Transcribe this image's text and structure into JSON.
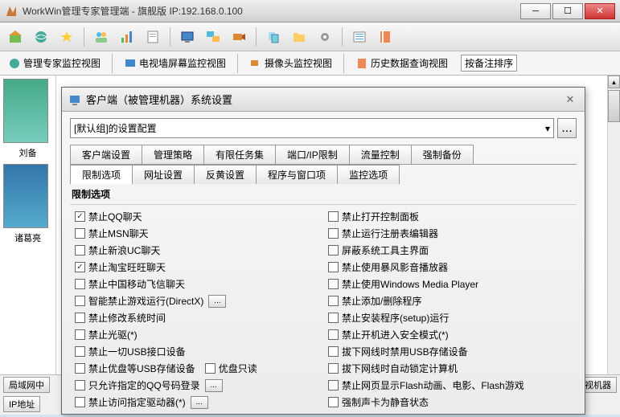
{
  "title": "WorkWin管理专家管理端 - 旗舰版 IP:192.168.0.100",
  "views": {
    "v1": "管理专家监控视图",
    "v2": "电视墙屏幕监控视图",
    "v3": "摄像头监控视图",
    "v4": "历史数据查询视图"
  },
  "sort_label": "按备注排序",
  "thumbs": {
    "t1": "刘备",
    "t2": "诸葛亮"
  },
  "bottom": {
    "lan": "局域网中",
    "ip": "IP地址",
    "monitor": "监视机器"
  },
  "dialog": {
    "title": "客户端（被管理机器）系统设置",
    "combo": "[默认组]的设置配置",
    "tabs_row1": [
      "客户端设置",
      "管理策略",
      "有限任务集",
      "端口/IP限制",
      "流量控制",
      "强制备份"
    ],
    "tabs_row2": [
      "限制选项",
      "网址设置",
      "反黄设置",
      "程序与窗口项",
      "监控选项"
    ],
    "group": "限制选项",
    "left": [
      {
        "c": true,
        "t": "禁止QQ聊天"
      },
      {
        "c": false,
        "t": "禁止MSN聊天"
      },
      {
        "c": false,
        "t": "禁止新浪UC聊天"
      },
      {
        "c": true,
        "t": "禁止淘宝旺旺聊天"
      },
      {
        "c": false,
        "t": "禁止中国移动飞信聊天"
      },
      {
        "c": false,
        "t": "智能禁止游戏运行(DirectX)",
        "btn": true
      },
      {
        "c": false,
        "t": "禁止修改系统时间"
      },
      {
        "c": false,
        "t": "禁止光驱(*)"
      },
      {
        "c": false,
        "t": "禁止一切USB接口设备"
      },
      {
        "c": false,
        "t": "禁止优盘等USB存储设备",
        "extra": "优盘只读"
      },
      {
        "c": false,
        "t": "只允许指定的QQ号码登录",
        "btn": true
      },
      {
        "c": false,
        "t": "禁止访问指定驱动器(*)",
        "btn": true
      }
    ],
    "right": [
      {
        "c": false,
        "t": "禁止打开控制面板"
      },
      {
        "c": false,
        "t": "禁止运行注册表编辑器"
      },
      {
        "c": false,
        "t": "屏蔽系统工具主界面"
      },
      {
        "c": false,
        "t": "禁止使用暴风影音播放器"
      },
      {
        "c": false,
        "t": "禁止使用Windows Media Player"
      },
      {
        "c": false,
        "t": "禁止添加/删除程序"
      },
      {
        "c": false,
        "t": "禁止安装程序(setup)运行"
      },
      {
        "c": false,
        "t": "禁止开机进入安全模式(*)"
      },
      {
        "c": false,
        "t": "拔下网线时禁用USB存储设备"
      },
      {
        "c": false,
        "t": "拔下网线时自动锁定计算机"
      },
      {
        "c": false,
        "t": "禁止网页显示Flash动画、电影、Flash游戏"
      },
      {
        "c": false,
        "t": "强制声卡为静音状态"
      }
    ]
  }
}
